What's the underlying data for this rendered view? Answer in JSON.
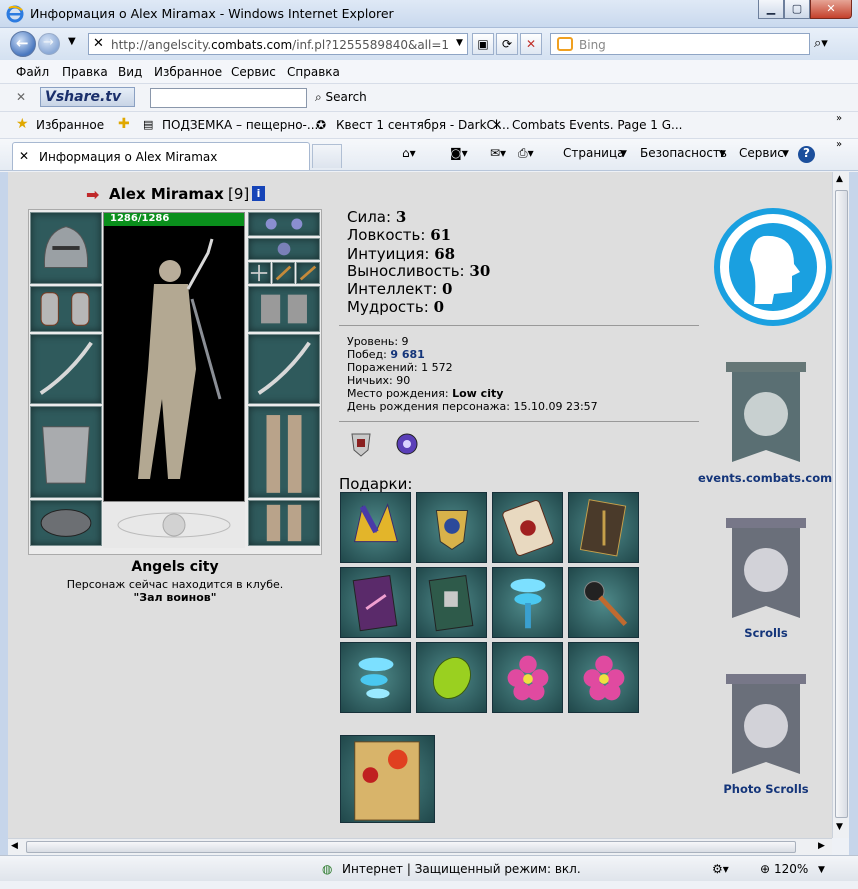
{
  "window": {
    "title": "Информация о Alex Miramax - Windows Internet Explorer"
  },
  "address": {
    "url_prefix": "http://angelscity.",
    "url_domain": "combats.com",
    "url_suffix": "/inf.pl?1255589840&all=1"
  },
  "search": {
    "placeholder": "Bing"
  },
  "menu": [
    "Файл",
    "Правка",
    "Вид",
    "Избранное",
    "Сервис",
    "Справка"
  ],
  "vshare": {
    "logo": "Vshare.tv",
    "search_label": "Search"
  },
  "favorites": {
    "label": "Избранное",
    "items": [
      "ПОДЗЕМКА – пещерно-...",
      "Квест 1 сентября - DarkCl...",
      "Combats Events. Page 1 G..."
    ]
  },
  "tab": {
    "label": "Информация о Alex Miramax"
  },
  "commands": {
    "page": "Страница",
    "safety": "Безопасность",
    "tools": "Сервис"
  },
  "character": {
    "name": "Alex Miramax",
    "level_tag": "[9]",
    "hp": "1286/1286",
    "city": "Angels city",
    "location_text": "Персонаж сейчас находится в клубе.",
    "location_room": "\"Зал воинов\""
  },
  "stats": [
    {
      "label": "Сила:",
      "value": "3"
    },
    {
      "label": "Ловкость:",
      "value": "61"
    },
    {
      "label": "Интуиция:",
      "value": "68"
    },
    {
      "label": "Выносливость:",
      "value": "30"
    },
    {
      "label": "Интеллект:",
      "value": "0"
    },
    {
      "label": "Мудрость:",
      "value": "0"
    }
  ],
  "info": {
    "level_label": "Уровень:",
    "level": "9",
    "wins_label": "Побед:",
    "wins": "9 681",
    "losses_label": "Поражений:",
    "losses": "1 572",
    "draws_label": "Ничьих:",
    "draws": "90",
    "birthplace_label": "Место рождения:",
    "birthplace": "Low city",
    "birthday_label": "День рождения персонажа:",
    "birthday": "15.10.09 23:57"
  },
  "gifts_label": "Подарки:",
  "banners": {
    "events": "events.combats.com",
    "scrolls": "Scrolls",
    "photo": "Photo Scrolls"
  },
  "status": {
    "zone": "Интернет | Защищенный режим: вкл.",
    "zoom": "120%"
  },
  "colors": {
    "hp_bar": "#0a8f1c",
    "link": "#14357a",
    "page_bg": "#dedede",
    "slot_bg": "#2f5a5c"
  }
}
